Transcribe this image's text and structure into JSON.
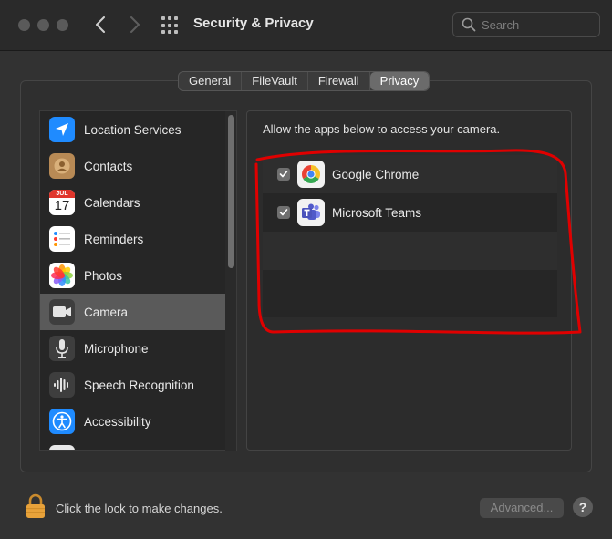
{
  "window": {
    "title": "Security & Privacy",
    "search_placeholder": "Search"
  },
  "tabs": [
    {
      "label": "General",
      "active": false
    },
    {
      "label": "FileVault",
      "active": false
    },
    {
      "label": "Firewall",
      "active": false
    },
    {
      "label": "Privacy",
      "active": true
    }
  ],
  "sidebar": {
    "items": [
      {
        "label": "Location Services",
        "icon": "location-arrow-icon"
      },
      {
        "label": "Contacts",
        "icon": "contacts-icon"
      },
      {
        "label": "Calendars",
        "icon": "calendar-icon",
        "icon_month": "JUL",
        "icon_day": "17"
      },
      {
        "label": "Reminders",
        "icon": "reminders-icon"
      },
      {
        "label": "Photos",
        "icon": "photos-icon"
      },
      {
        "label": "Camera",
        "icon": "camera-icon",
        "selected": true
      },
      {
        "label": "Microphone",
        "icon": "microphone-icon"
      },
      {
        "label": "Speech Recognition",
        "icon": "speech-waveform-icon"
      },
      {
        "label": "Accessibility",
        "icon": "accessibility-icon"
      }
    ]
  },
  "content": {
    "heading": "Allow the apps below to access your camera.",
    "apps": [
      {
        "label": "Google Chrome",
        "checked": true,
        "icon": "chrome-icon"
      },
      {
        "label": "Microsoft Teams",
        "checked": true,
        "icon": "teams-icon"
      }
    ]
  },
  "footer": {
    "lock_label": "Click the lock to make changes.",
    "advanced_label": "Advanced...",
    "help_label": "?"
  },
  "colors": {
    "selection": "#5a5a5a",
    "annotation": "#e00000",
    "location_blue": "#1f8bff",
    "lock_gold": "#e8a23a"
  }
}
